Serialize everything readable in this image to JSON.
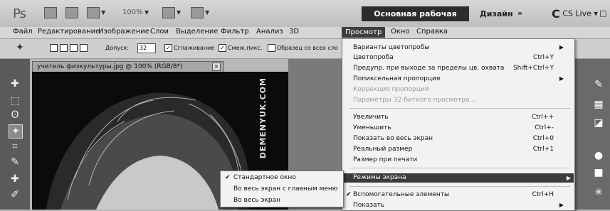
{
  "app": {
    "logo": "Ps",
    "zoom_value": "100%",
    "workspace_label": "Основная рабочая среда",
    "design_label": "Дизайн",
    "more_label": "»",
    "cslive_label": "CS Live",
    "minimize": "–",
    "restore": "□"
  },
  "menubar": {
    "items": [
      "Файл",
      "Редактирование",
      "Изображение",
      "Слои",
      "Выделение",
      "Фильтр",
      "Анализ",
      "3D",
      "Просмотр",
      "Окно",
      "Справка"
    ]
  },
  "options": {
    "tolerance_label": "Допуск:",
    "tolerance_value": "32",
    "smoothing_label": "Сглаживание",
    "adjacent_label": "Смеж.пикс.",
    "all_layers_label": "Образец со всех сло"
  },
  "document": {
    "tab_title": "учитель физкультуры.jpg @ 100% (RGB/8*)",
    "close": "×",
    "watermark": "DEMENYUK.COM"
  },
  "view_menu": {
    "items": [
      {
        "label": "Варианты цветопробы",
        "shortcut": "",
        "submenu": true,
        "disabled": false
      },
      {
        "label": "Цветопроба",
        "shortcut": "Ctrl+Y",
        "submenu": false,
        "disabled": false
      },
      {
        "label": "Предупр. при выходе за пределы цв. охвата",
        "shortcut": "Shift+Ctrl+Y",
        "submenu": false,
        "disabled": false
      },
      {
        "label": "Попиксельная пропорция",
        "shortcut": "",
        "submenu": true,
        "disabled": false
      },
      {
        "label": "Коррекция пропорций",
        "shortcut": "",
        "submenu": false,
        "disabled": true
      },
      {
        "label": "Параметры 32-битного просмотра...",
        "shortcut": "",
        "submenu": false,
        "disabled": true
      },
      {
        "label": "Увеличить",
        "shortcut": "Ctrl++",
        "submenu": false,
        "disabled": false
      },
      {
        "label": "Уменьшить",
        "shortcut": "Ctrl+-",
        "submenu": false,
        "disabled": false
      },
      {
        "label": "Показать во весь экран",
        "shortcut": "Ctrl+0",
        "submenu": false,
        "disabled": false
      },
      {
        "label": "Реальный размер",
        "shortcut": "Ctrl+1",
        "submenu": false,
        "disabled": false
      },
      {
        "label": "Размер при печати",
        "shortcut": "",
        "submenu": false,
        "disabled": false
      },
      {
        "label": "Режимы экрана",
        "shortcut": "",
        "submenu": true,
        "disabled": false,
        "highlighted": true
      },
      {
        "label": "Вспомогательные элементы",
        "shortcut": "Ctrl+H",
        "submenu": false,
        "disabled": false,
        "checked": true
      },
      {
        "label": "Показать",
        "shortcut": "",
        "submenu": true,
        "disabled": false
      }
    ]
  },
  "screen_modes_submenu": {
    "items": [
      {
        "label": "Стандартное окно",
        "checked": true
      },
      {
        "label": "Во весь экран с главным меню",
        "checked": false
      },
      {
        "label": "Во весь экран",
        "checked": false
      }
    ]
  },
  "icons": {
    "check": "✔",
    "submenu_arrow": "▶"
  }
}
